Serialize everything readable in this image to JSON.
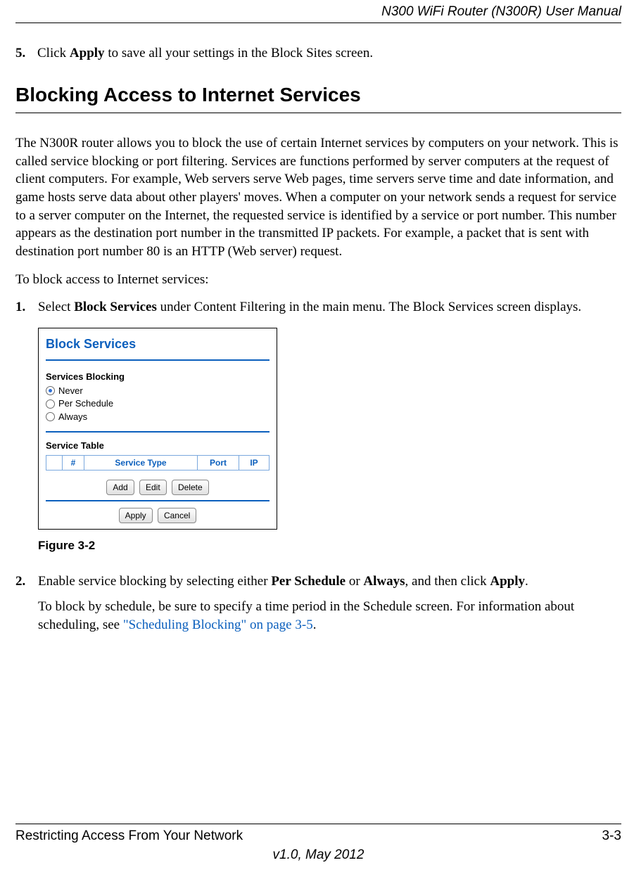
{
  "header": {
    "title": "N300 WiFi Router (N300R) User Manual"
  },
  "step5": {
    "num": "5.",
    "pre": "Click ",
    "bold": "Apply",
    "post": " to save all your settings in the Block Sites screen."
  },
  "heading": "Blocking Access to Internet Services",
  "intro": "The N300R router allows you to block the use of certain Internet services by computers on your network. This is called service blocking or port filtering. Services are functions performed by server computers at the request of client computers. For example, Web servers serve Web pages, time servers serve time and date information, and game hosts serve data about other players' moves. When a computer on your network sends a request for service to a server computer on the Internet, the requested service is identified by a service or port number. This number appears as the destination port number in the transmitted IP packets. For example, a packet that is sent with destination port number 80 is an HTTP (Web server) request.",
  "lead": "To block access to Internet services:",
  "step1": {
    "num": "1.",
    "pre": "Select ",
    "bold": "Block Services",
    "post": " under Content Filtering in the main menu. The Block Services screen displays."
  },
  "screenshot": {
    "title": "Block Services",
    "section1": "Services Blocking",
    "options": [
      {
        "label": "Never",
        "selected": true
      },
      {
        "label": "Per Schedule",
        "selected": false
      },
      {
        "label": "Always",
        "selected": false
      }
    ],
    "section2": "Service Table",
    "columns": {
      "num": "#",
      "type": "Service Type",
      "port": "Port",
      "ip": "IP"
    },
    "buttons_row1": {
      "add": "Add",
      "edit": "Edit",
      "delete": "Delete"
    },
    "buttons_row2": {
      "apply": "Apply",
      "cancel": "Cancel"
    }
  },
  "figure_caption": "Figure 3-2",
  "step2": {
    "num": "2.",
    "pre": "Enable service blocking by selecting either ",
    "bold1": "Per Schedule",
    "mid1": " or ",
    "bold2": "Always",
    "mid2": ", and then click ",
    "bold3": "Apply",
    "post": ".",
    "para2_pre": "To block by schedule, be sure to specify a time period in the Schedule screen. For information about scheduling, see ",
    "link": "\"Scheduling Blocking\" on page 3-5",
    "para2_post": "."
  },
  "footer": {
    "left": "Restricting Access From Your Network",
    "right": "3-3",
    "version": "v1.0, May 2012"
  }
}
